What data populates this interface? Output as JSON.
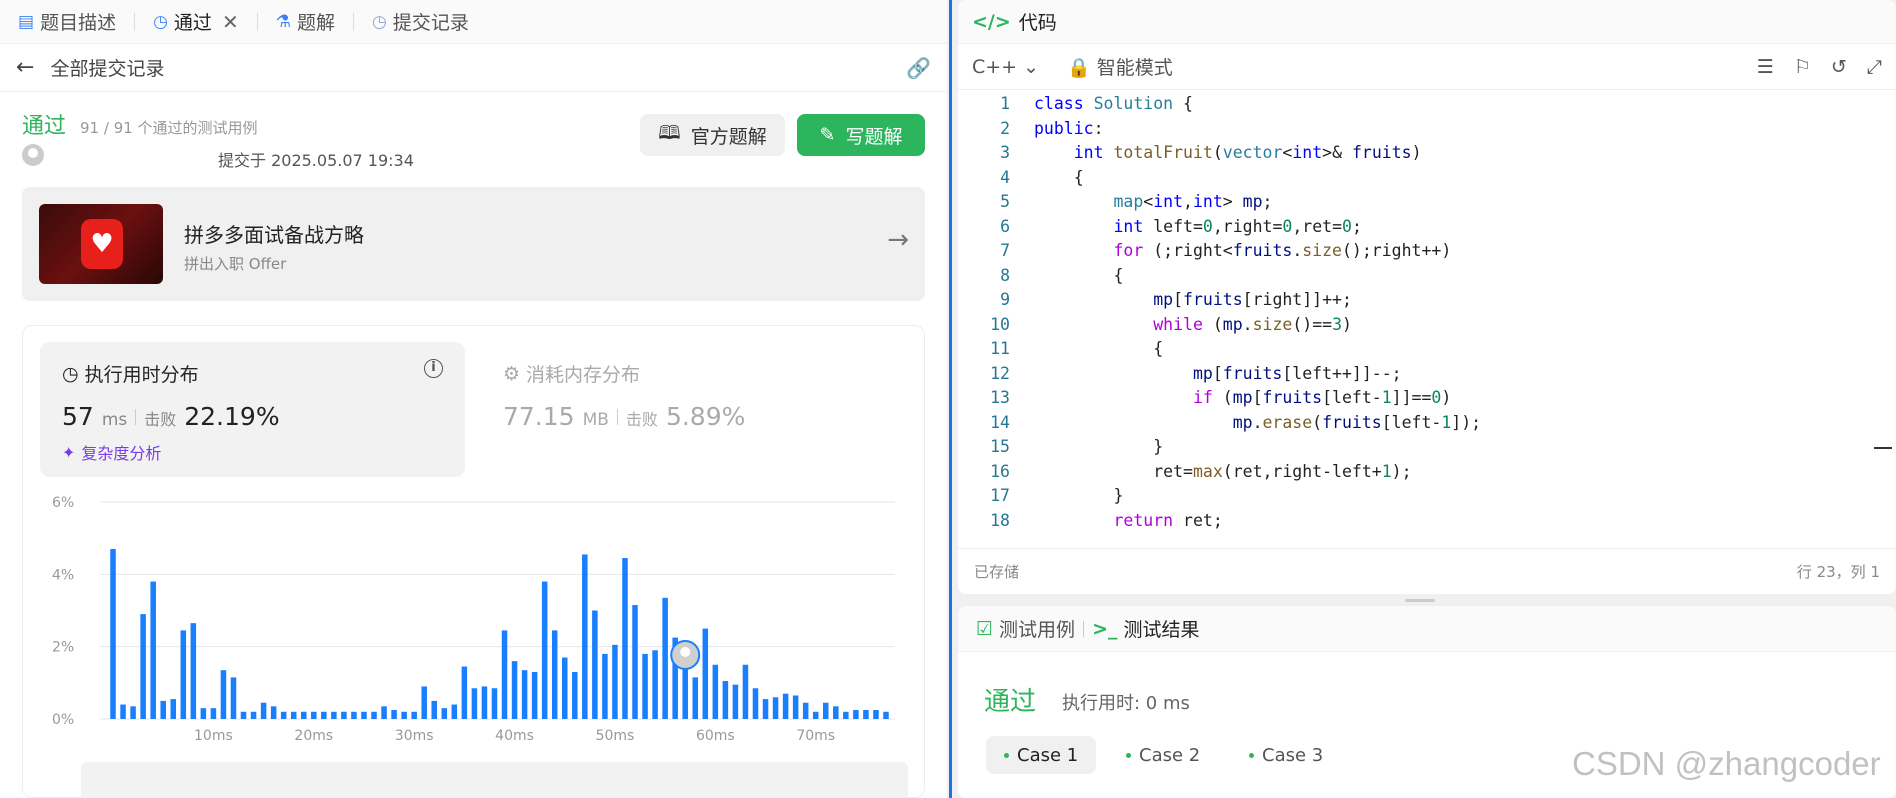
{
  "left_tabs": [
    {
      "label": "题目描述",
      "icon": "doc-icon"
    },
    {
      "label": "通过",
      "icon": "history-icon"
    },
    {
      "label": "题解",
      "icon": "flask-icon"
    },
    {
      "label": "提交记录",
      "icon": "history-icon"
    }
  ],
  "subbar": {
    "title": "全部提交记录"
  },
  "submission": {
    "status": "通过",
    "passed_tests": "91 / 91 个通过的测试用例",
    "submitted_at": "提交于 2025.05.07 19:34",
    "official_btn": "官方题解",
    "write_btn": "写题解"
  },
  "promo": {
    "title": "拼多多面试备战方略",
    "subtitle": "拼出入职 Offer"
  },
  "runtime": {
    "title": "执行用时分布",
    "value": "57",
    "unit": "ms",
    "beat_label": "击败",
    "beat_value": "22.19%",
    "analysis": "复杂度分析"
  },
  "memory": {
    "title": "消耗内存分布",
    "value": "77.15",
    "unit": "MB",
    "beat_label": "击败",
    "beat_value": "5.89%"
  },
  "chart_data": {
    "type": "bar",
    "ylabels": [
      "6%",
      "4%",
      "2%",
      "0%"
    ],
    "ylim": [
      0,
      6
    ],
    "xticks": [
      {
        "ms": 10,
        "label": "10ms"
      },
      {
        "ms": 20,
        "label": "20ms"
      },
      {
        "ms": 30,
        "label": "30ms"
      },
      {
        "ms": 40,
        "label": "40ms"
      },
      {
        "ms": 50,
        "label": "50ms"
      },
      {
        "ms": 60,
        "label": "60ms"
      },
      {
        "ms": 70,
        "label": "70ms"
      }
    ],
    "x_start_ms": 0,
    "x_step_ms": 1,
    "values": [
      4.7,
      0.4,
      0.35,
      2.9,
      3.8,
      0.5,
      0.55,
      2.45,
      2.65,
      0.3,
      0.3,
      1.35,
      1.15,
      0.2,
      0.2,
      0.45,
      0.35,
      0.2,
      0.2,
      0.2,
      0.2,
      0.2,
      0.2,
      0.2,
      0.2,
      0.2,
      0.2,
      0.35,
      0.25,
      0.2,
      0.2,
      0.9,
      0.5,
      0.3,
      0.4,
      1.45,
      0.85,
      0.9,
      0.85,
      2.45,
      1.6,
      1.35,
      1.3,
      3.8,
      2.45,
      1.7,
      1.3,
      4.55,
      3.0,
      1.8,
      2.05,
      4.45,
      3.15,
      1.8,
      1.9,
      3.35,
      2.25,
      1.55,
      1.15,
      2.5,
      1.5,
      1.05,
      0.95,
      1.5,
      0.85,
      0.55,
      0.6,
      0.7,
      0.65,
      0.45,
      0.2,
      0.45,
      0.35,
      0.2,
      0.25,
      0.25,
      0.25,
      0.2
    ],
    "highlight_ms": 57
  },
  "code_pane": {
    "title": "代码",
    "language": "C++",
    "mode": "智能模式",
    "saved": "已存储",
    "cursor": "行 23，列 1"
  },
  "code_lines": [
    "class Solution {",
    "public:",
    "    int totalFruit(vector<int>& fruits)",
    "    {",
    "        map<int,int> mp;",
    "        int left=0,right=0,ret=0;",
    "        for (;right<fruits.size();right++)",
    "        {",
    "            mp[fruits[right]]++;",
    "            while (mp.size()==3)",
    "            {",
    "                mp[fruits[left++]]--;",
    "                if (mp[fruits[left-1]]==0)",
    "                    mp.erase(fruits[left-1]);",
    "            }",
    "            ret=max(ret,right-left+1);",
    "        }",
    "        return ret;"
  ],
  "bottom": {
    "tab_testcase": "测试用例",
    "tab_result": "测试结果",
    "status": "通过",
    "time": "执行用时: 0 ms",
    "cases": [
      "Case 1",
      "Case 2",
      "Case 3"
    ]
  },
  "watermark": "CSDN @zhangcoder",
  "colors": {
    "accent_green": "#2db55d",
    "bar_blue": "#1a7fff",
    "divider_blue": "#1a73e8"
  }
}
